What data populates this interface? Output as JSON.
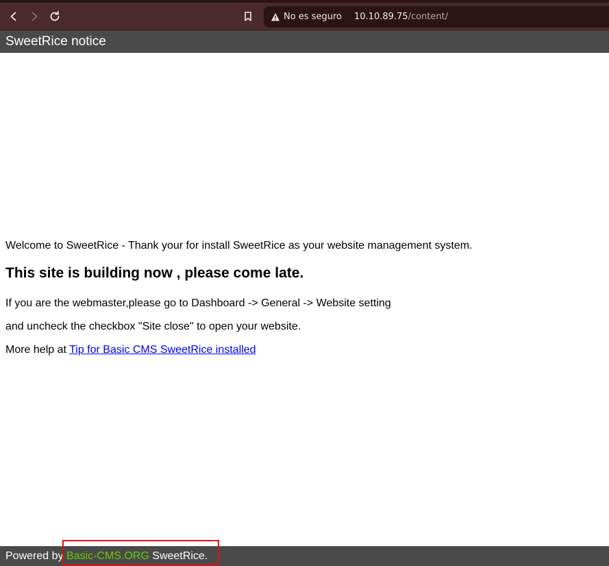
{
  "browser": {
    "security_label": "No es seguro",
    "url_host": "10.10.89.75",
    "url_path": "/content/",
    "icons": [
      "back-icon",
      "forward-icon",
      "reload-icon",
      "bookmark-icon",
      "warning-icon"
    ]
  },
  "page": {
    "header_title": "SweetRice notice",
    "welcome": "Welcome to SweetRice - Thank your for install SweetRice as your website management system.",
    "building": "This site is building now , please come late.",
    "instruction_1": "If you are the webmaster,please go to Dashboard -> General -> Website setting",
    "instruction_2": "and uncheck the checkbox \"Site close\" to open your website.",
    "help_prefix": "More help at ",
    "help_link": "Tip for Basic CMS SweetRice installed"
  },
  "footer": {
    "prefix": "Powered by ",
    "link": "Basic-CMS.ORG",
    "suffix": " SweetRice."
  },
  "colors": {
    "browser_bar": "#4a2a2a",
    "header_bg": "#4a4a4a",
    "footer_link": "#66cc00",
    "highlight": "#e01010",
    "link": "#0000ee"
  }
}
